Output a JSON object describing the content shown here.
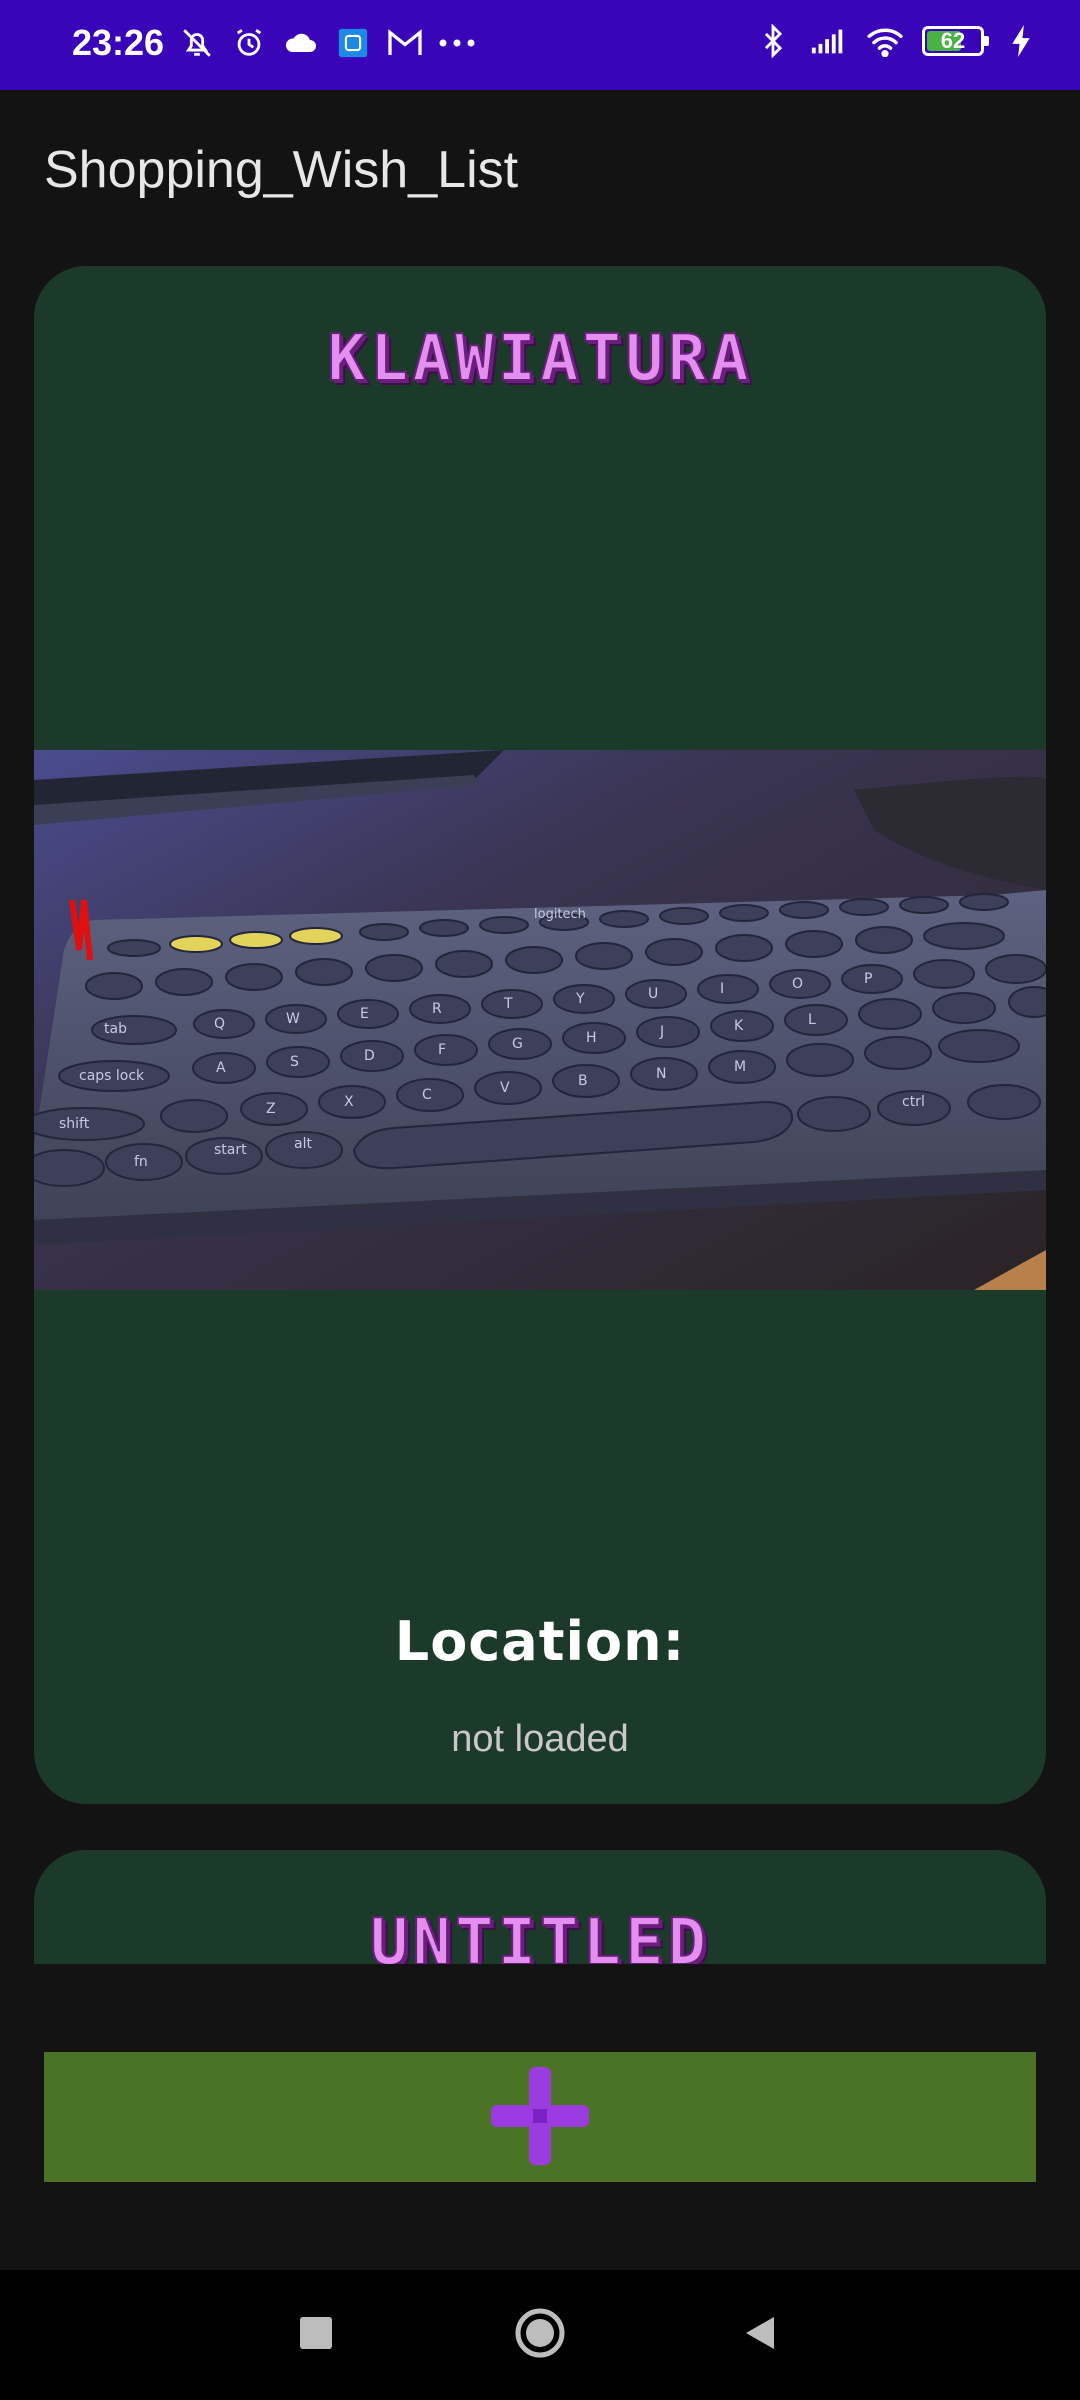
{
  "status_bar": {
    "time": "23:26",
    "battery": "62",
    "left_icons": [
      "bell-off-icon",
      "alarm-icon",
      "cloud-icon",
      "app-icon",
      "gmail-icon",
      "more-dots-icon"
    ],
    "right_icons": [
      "bluetooth-icon",
      "signal-icon",
      "wifi-icon",
      "battery-icon",
      "charging-icon"
    ],
    "background": "#3a05b8"
  },
  "app": {
    "title": "Shopping_Wish_List"
  },
  "items": [
    {
      "title": "KLAWIATURA",
      "image": "keyboard-photo",
      "location_label": "Location:",
      "location_value": "not loaded"
    },
    {
      "title": "UNTITLED"
    }
  ],
  "colors": {
    "background": "#131313",
    "card": "#1c3a2a",
    "title_pink": "#e48ef0",
    "add_button": "#4a7326",
    "plus_purple": "#9b3ce0"
  },
  "add_button": {
    "icon": "plus-icon"
  },
  "nav_bar": {
    "buttons": [
      "recents-square-icon",
      "home-circle-icon",
      "back-triangle-icon"
    ]
  }
}
